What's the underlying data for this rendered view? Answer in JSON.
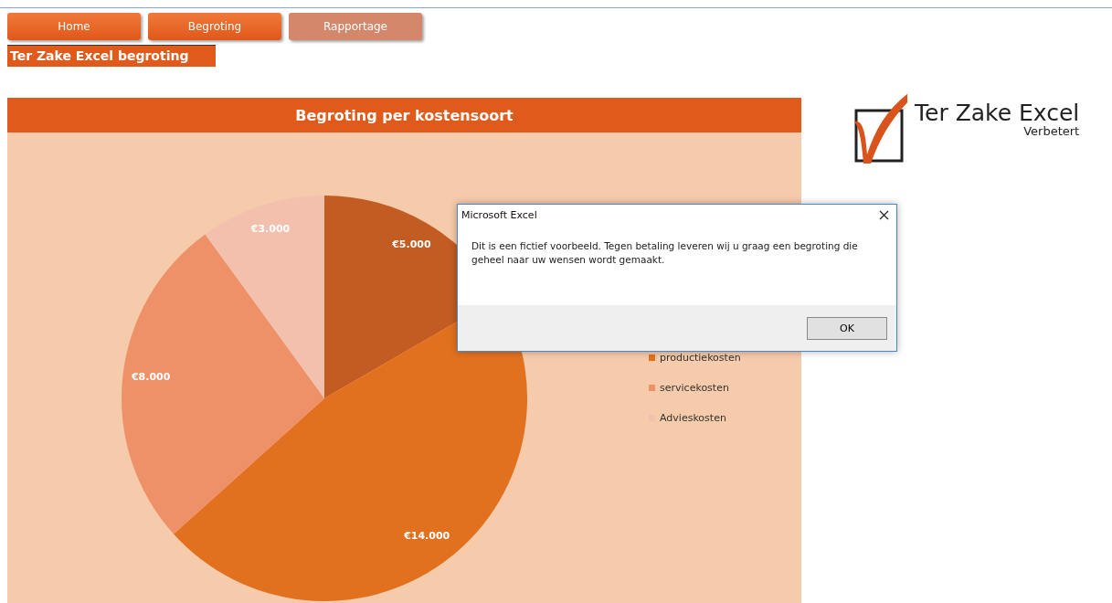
{
  "nav_buttons": [
    {
      "label": "Home",
      "selected": false
    },
    {
      "label": "Begroting",
      "selected": false
    },
    {
      "label": "Rapportage",
      "selected": true
    }
  ],
  "sheet_title": "Ter Zake Excel begroting",
  "chart_panel": {
    "title": "Begroting per kostensoort",
    "chart_data": {
      "type": "pie",
      "categories": [
        null,
        "productiekosten",
        "servicekosten",
        "Advieskosten"
      ],
      "values": [
        5000,
        14000,
        8000,
        3000
      ],
      "colors": [
        "#c25c22",
        "#e2711f",
        "#ee9168",
        "#f3c0ae"
      ],
      "value_labels": [
        "€5.000",
        "€14.000",
        "€8.000",
        "€3.000"
      ]
    }
  },
  "logo": {
    "name": "Ter Zake Excel",
    "tagline": "Verbetert"
  },
  "dialog": {
    "title": "Microsoft Excel",
    "message": "Dit is een fictief voorbeeld. Tegen betaling leveren wij u graag een begroting die geheel naar uw wensen wordt gemaakt.",
    "button": "OK"
  }
}
